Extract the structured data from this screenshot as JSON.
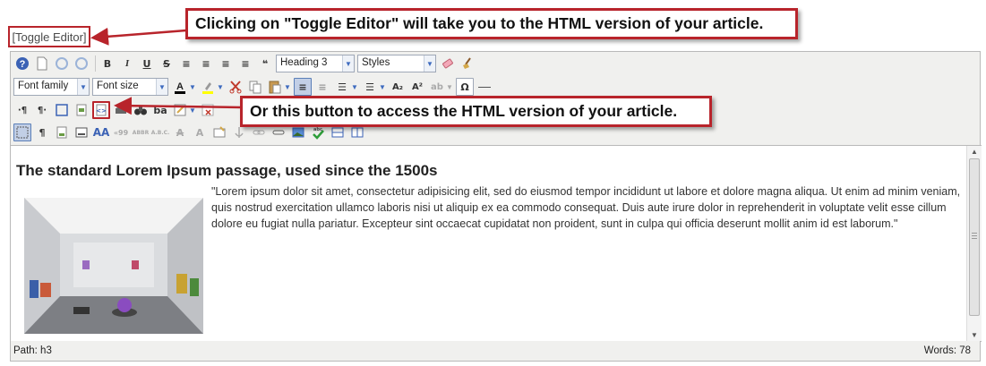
{
  "toggle_link": {
    "label": "[Toggle Editor]"
  },
  "callouts": {
    "toggle": "Clicking on \"Toggle Editor\" will take you to the HTML version of your article.",
    "html_button": "Or this button to access the HTML version of your article."
  },
  "toolbar": {
    "format_select": "Heading 3",
    "styles_select": "Styles",
    "font_family_select": "Font family",
    "font_size_select": "Font size",
    "bold": "B",
    "italic": "I",
    "underline": "U",
    "strike": "S",
    "quote": "❝",
    "abbr": "ABBR",
    "acronym": "A.B.C.",
    "omega": "Ω"
  },
  "content": {
    "heading": "The standard Lorem Ipsum passage, used since the 1500s",
    "paragraph": "\"Lorem ipsum dolor sit amet, consectetur adipisicing elit, sed do eiusmod tempor incididunt ut labore et dolore magna aliqua. Ut enim ad minim veniam, quis nostrud exercitation ullamco laboris nisi ut aliquip ex ea commodo consequat. Duis aute irure dolor in reprehenderit in voluptate velit esse cillum dolore eu fugiat nulla pariatur. Excepteur sint occaecat cupidatat non proident, sunt in culpa qui officia deserunt mollit anim id est laborum.\""
  },
  "status": {
    "path": "Path:  h3",
    "words": "Words: 78"
  },
  "colors": {
    "callout_border": "#b8242b",
    "toolbar_bg": "#f0f0ee",
    "active_button": "#c2cfe6"
  }
}
